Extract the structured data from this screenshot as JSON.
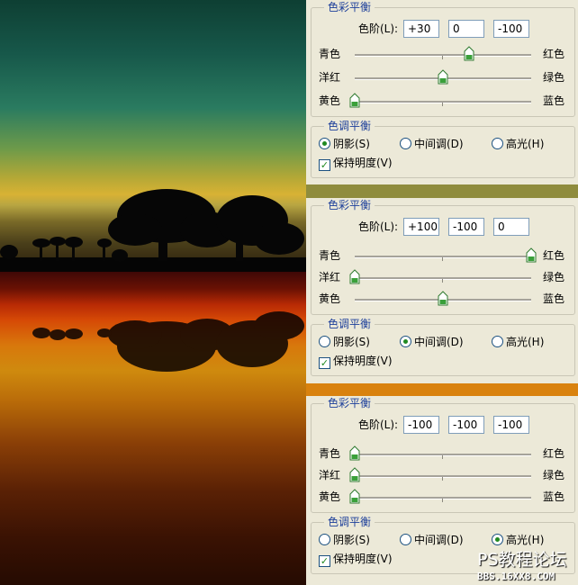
{
  "labels": {
    "color_balance": "色彩平衡",
    "levels": "色阶(L):",
    "cyan": "青色",
    "red": "红色",
    "magenta": "洋红",
    "green": "绿色",
    "yellow": "黄色",
    "blue": "蓝色",
    "tone_balance": "色调平衡",
    "shadows": "阴影(S)",
    "midtones": "中间调(D)",
    "highlights": "高光(H)",
    "preserve_luminosity": "保持明度(V)"
  },
  "panels": [
    {
      "levels": [
        "+30",
        "0",
        "-100"
      ],
      "sliders": [
        30,
        0,
        -100
      ],
      "tone": "shadows",
      "preserve": true
    },
    {
      "levels": [
        "+100",
        "-100",
        "0"
      ],
      "sliders": [
        100,
        -100,
        0
      ],
      "tone": "midtones",
      "preserve": true
    },
    {
      "levels": [
        "-100",
        "-100",
        "-100"
      ],
      "sliders": [
        -100,
        -100,
        -100
      ],
      "tone": "highlights",
      "preserve": true
    }
  ],
  "watermark": {
    "title": "PS教程论坛",
    "url": "BBS.16XX8.COM"
  },
  "colors": {
    "legend": "#1d3f9a",
    "dialog_bg": "#ece9d8",
    "accent_green": "#218a21"
  }
}
